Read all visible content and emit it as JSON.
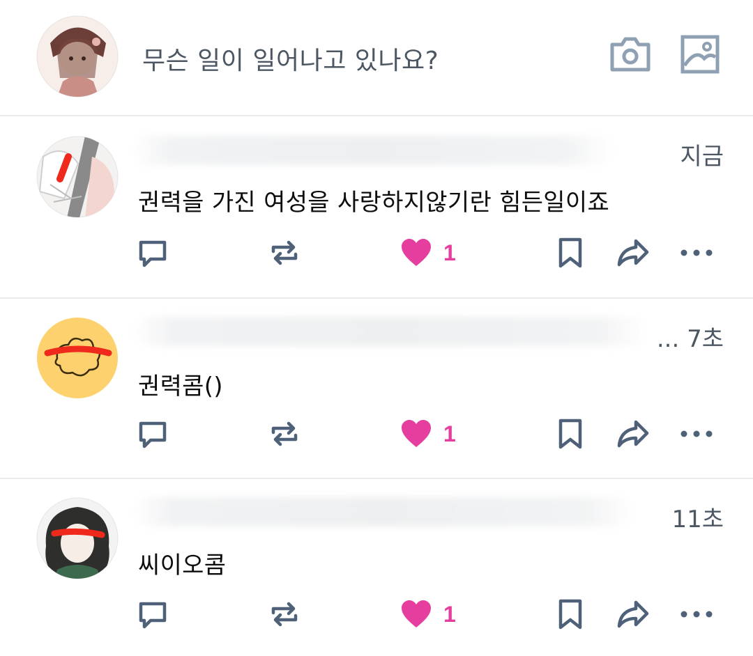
{
  "composer": {
    "prompt": "무슨 일이 일어나고 있나요?",
    "camera_icon": "camera-icon",
    "image_icon": "image-icon"
  },
  "posts": [
    {
      "time": "지금",
      "text": "권력을 가진 여성을 사랑하지않기란 힘든일이죠",
      "likes": "1",
      "avatar": "avatar-illustration-gray"
    },
    {
      "time": "... 7초",
      "text": "권력콤()",
      "likes": "1",
      "avatar": "avatar-yellow-doodle"
    },
    {
      "time": "11초",
      "text": "씨이오콤",
      "likes": "1",
      "avatar": "avatar-dark-hair"
    }
  ],
  "colors": {
    "icon": "#8ea0b2",
    "action": "#4e6178",
    "like": "#e63e9f",
    "divider": "#e9ecef",
    "muted_text": "#4d5763"
  }
}
